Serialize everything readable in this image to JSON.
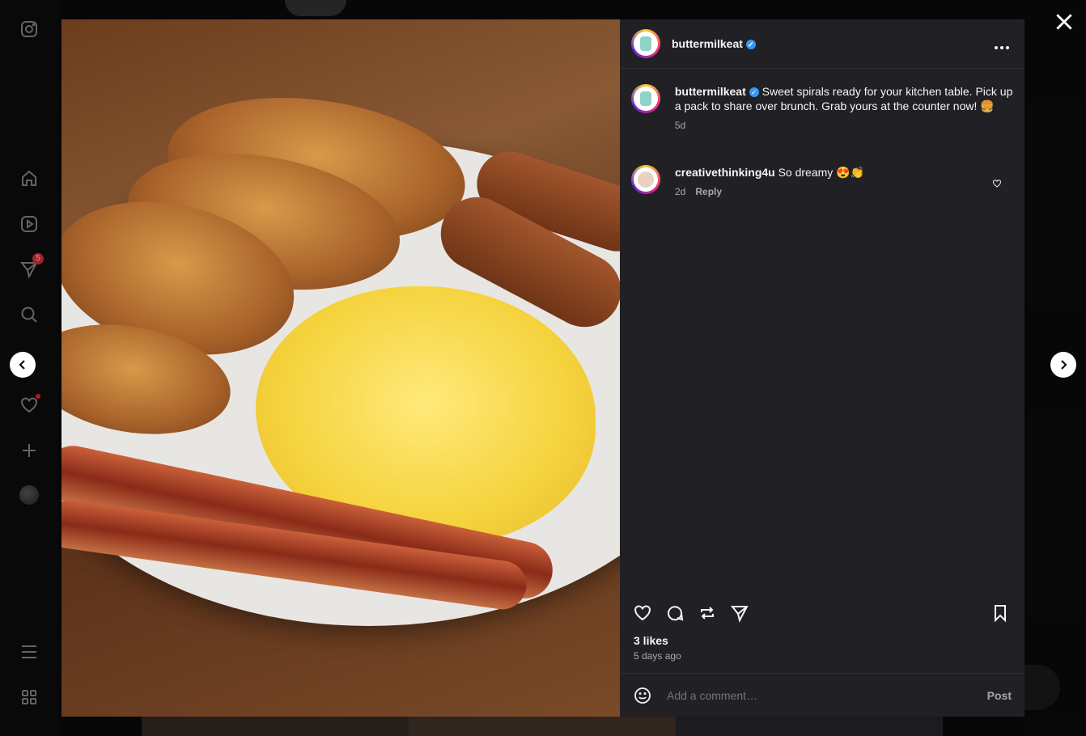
{
  "sidebar": {
    "icons": [
      "instagram-icon",
      "home-icon",
      "reels-icon",
      "messages-icon",
      "search-icon",
      "explore-icon",
      "notifications-icon",
      "create-icon",
      "profile-avatar",
      "menu-icon",
      "more-icon"
    ],
    "messages_badge": "5"
  },
  "post": {
    "author": "buttermilkeat",
    "verified": true,
    "caption_author": "buttermilkeat",
    "caption_text": "Sweet spirals ready for your kitchen table. Pick up a pack to share over brunch. Grab yours at the counter now! 🍔",
    "caption_time": "5d",
    "comments": [
      {
        "author": "creativethinking4u",
        "text": "So dreamy 😍👏",
        "time": "2d",
        "reply_label": "Reply"
      }
    ],
    "likes": "3 likes",
    "posted_ago": "5 days ago",
    "comment_placeholder": "Add a comment…",
    "post_label": "Post"
  },
  "colors": {
    "panel_bg": "#212125",
    "verified": "#3897f0",
    "muted_text": "#a8a8a8"
  }
}
